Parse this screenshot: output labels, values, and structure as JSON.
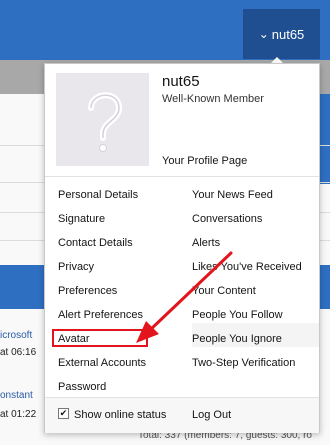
{
  "header": {
    "username": "nut65"
  },
  "background": {
    "faint_username": "nut65",
    "text_microsoft": "icrosoft",
    "text_time1": "at 06:16",
    "text_constant": "onstant",
    "text_time2": "at 01:22",
    "footer_stats": "Total: 337 (members: 7, guests: 300, ro"
  },
  "menu": {
    "profile": {
      "name": "nut65",
      "title": "Well-Known Member",
      "profile_link": "Your Profile Page"
    },
    "left_items": [
      "Personal Details",
      "Signature",
      "Contact Details",
      "Privacy",
      "Preferences",
      "Alert Preferences",
      "Avatar",
      "External Accounts",
      "Password"
    ],
    "right_items": [
      "Your News Feed",
      "Conversations",
      "Alerts",
      "Likes You've Received",
      "Your Content",
      "People You Follow",
      "People You Ignore",
      "Two-Step Verification"
    ],
    "footer": {
      "show_online_label": "Show online status",
      "show_online_checked": true,
      "checkmark": "✔",
      "logout_label": "Log Out"
    }
  },
  "annotation": {
    "highlight_color": "#e3141c"
  },
  "colors": {
    "header_bg": "#2e6fc2",
    "user_tab_bg": "#1f4f91"
  }
}
